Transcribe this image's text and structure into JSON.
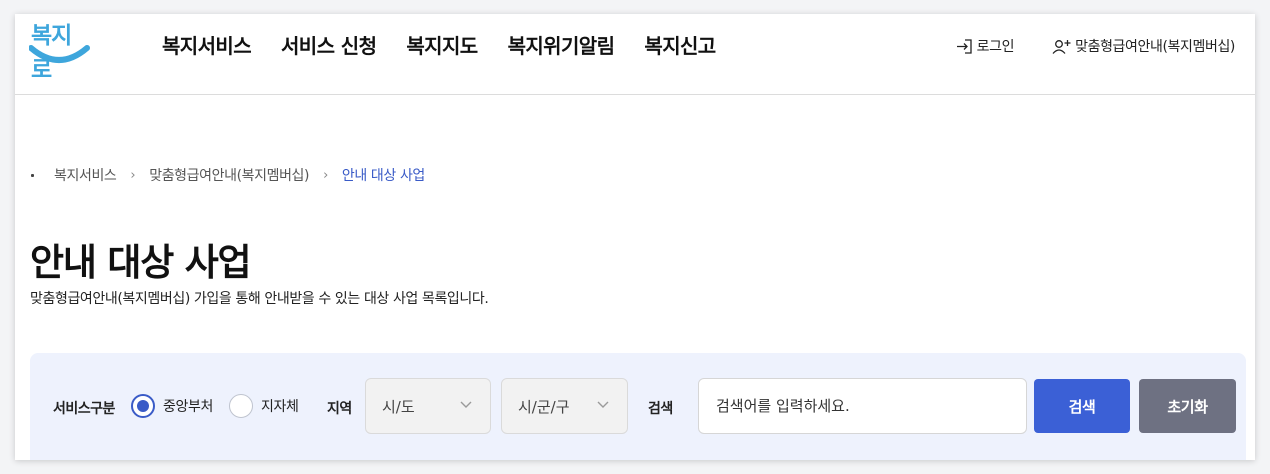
{
  "logo": {
    "text": "복지로"
  },
  "nav": {
    "items": [
      "복지서비스",
      "서비스 신청",
      "복지지도",
      "복지위기알림",
      "복지신고"
    ]
  },
  "util": {
    "login": "로그인",
    "membership": "맞춤형급여안내(복지멤버십)"
  },
  "breadcrumb": {
    "items": [
      "복지서비스",
      "맞춤형급여안내(복지멤버십)"
    ],
    "current": "안내 대상 사업"
  },
  "page": {
    "title": "안내 대상 사업",
    "description": "맞춤형급여안내(복지멤버십) 가입을 통해 안내받을 수 있는 대상 사업 목록입니다."
  },
  "search": {
    "service_type_label": "서비스구분",
    "options": [
      "중앙부처",
      "지자체"
    ],
    "selected": "중앙부처",
    "region_label": "지역",
    "sido_value": "시/도",
    "sigungu_value": "시/군/구",
    "keyword_label": "검색",
    "keyword_placeholder": "검색어를 입력하세요.",
    "search_button": "검색",
    "reset_button": "초기화"
  },
  "colors": {
    "brand": "#3ea6dc",
    "accent": "#3a5bc7",
    "search_button": "#3b60d6",
    "reset_button": "#6e7182",
    "panel_bg": "#eef2fd"
  }
}
